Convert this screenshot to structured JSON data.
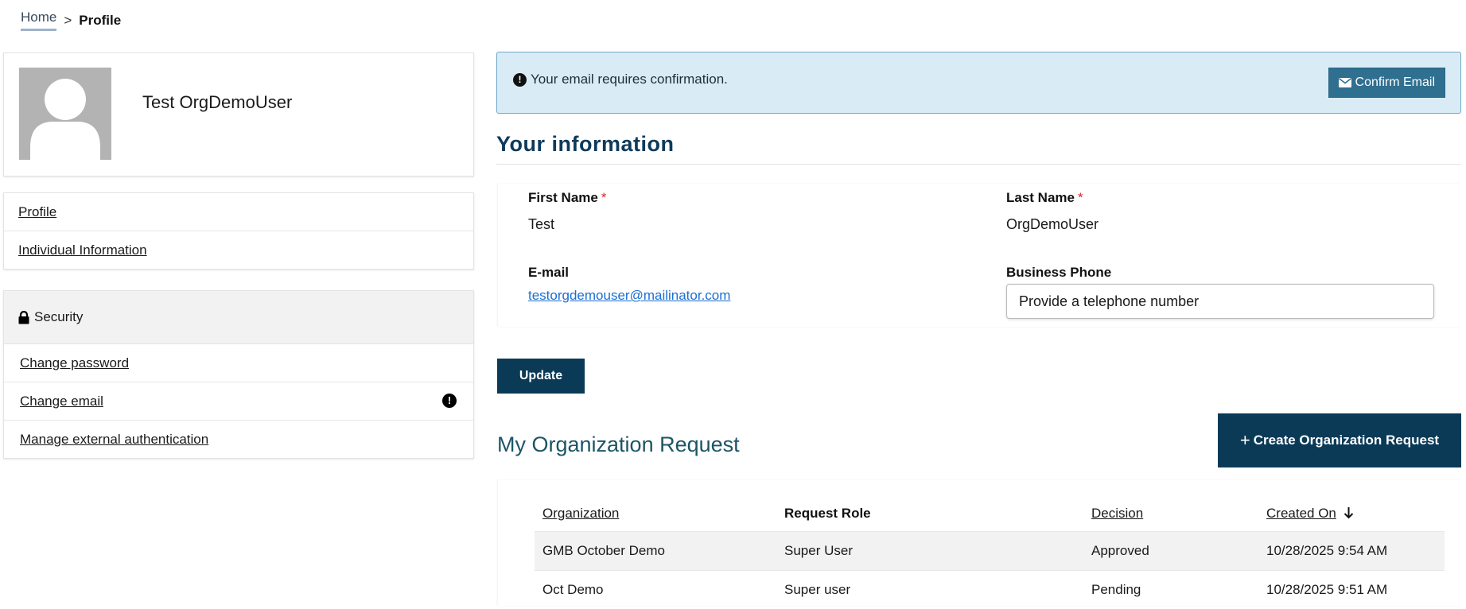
{
  "breadcrumb": {
    "home": "Home",
    "separator": ">",
    "current": "Profile"
  },
  "user": {
    "name": "Test OrgDemoUser",
    "avatar": "user-silhouette"
  },
  "nav": {
    "items": [
      {
        "label": "Profile"
      },
      {
        "label": "Individual Information"
      }
    ]
  },
  "security": {
    "header": "Security",
    "header_icon": "lock-icon",
    "items": [
      {
        "label": "Change password",
        "alert": ""
      },
      {
        "label": "Change email",
        "alert": "!"
      },
      {
        "label": "Manage external authentication",
        "alert": ""
      }
    ]
  },
  "email_alert": {
    "icon": "!",
    "message": "Your email requires confirmation.",
    "button_label": "Confirm Email",
    "button_icon": "envelope-icon"
  },
  "info": {
    "title": "Your information",
    "first_name_label": "First Name",
    "first_name_value": "Test",
    "last_name_label": "Last Name",
    "last_name_value": "OrgDemoUser",
    "required_marker": "*",
    "email_label": "E-mail",
    "email_value": "testorgdemouser@mailinator.com",
    "phone_label": "Business Phone",
    "phone_placeholder": "Provide a telephone number",
    "phone_value": "",
    "update_label": "Update"
  },
  "org": {
    "title": "My Organization Request",
    "create_plus": "+",
    "create_label": "Create Organization Request",
    "columns": {
      "organization": "Organization",
      "role": "Request Role",
      "decision": "Decision",
      "created": "Created On"
    },
    "sort": {
      "column": "created",
      "direction": "descending"
    },
    "rows": [
      {
        "organization": "GMB October Demo",
        "role": "Super User",
        "decision": "Approved",
        "created": "10/28/2025 9:54 AM"
      },
      {
        "organization": "Oct Demo",
        "role": "Super user",
        "decision": "Pending",
        "created": "10/28/2025 9:51 AM"
      }
    ]
  },
  "colors": {
    "primary": "#0b3a57",
    "alert_bg": "#d9ecf5",
    "alert_border": "#6fa9c8",
    "confirm_btn": "#2f6f8f",
    "link": "#1a6fd4",
    "required": "#d12a2a",
    "heading": "#0e3a5a"
  }
}
